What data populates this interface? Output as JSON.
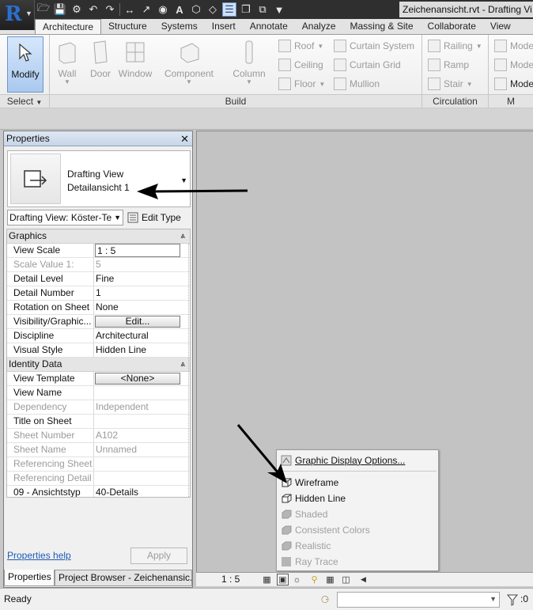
{
  "window": {
    "doc_title": "Zeichenansicht.rvt - Drafting Vi"
  },
  "ribbon": {
    "tabs": [
      "Architecture",
      "Structure",
      "Systems",
      "Insert",
      "Annotate",
      "Analyze",
      "Massing & Site",
      "Collaborate",
      "View"
    ],
    "active_tab": "Architecture",
    "modify_label": "Modify",
    "build_buttons": [
      "Wall",
      "Door",
      "Window",
      "Component",
      "Column"
    ],
    "build_small": [
      "Roof",
      "Ceiling",
      "Floor",
      "Curtain System",
      "Curtain Grid",
      "Mullion"
    ],
    "circulation_small": [
      "Railing",
      "Ramp",
      "Stair"
    ],
    "model_small": [
      "Mode",
      "Mode",
      "Mode"
    ],
    "panels": {
      "select": "Select",
      "build": "Build",
      "circulation": "Circulation",
      "model": "M"
    }
  },
  "properties": {
    "title": "Properties",
    "type_line1": "Drafting View",
    "type_line2": "Detailansicht 1",
    "filter_value": "Drafting View: Köster-Te",
    "edit_type_label": "Edit Type",
    "sections": {
      "graphics": "Graphics",
      "identity": "Identity Data"
    },
    "graphics_rows": [
      {
        "name": "View Scale",
        "value": "1 : 5"
      },
      {
        "name": "Scale Value    1:",
        "value": "5"
      },
      {
        "name": "Detail Level",
        "value": "Fine"
      },
      {
        "name": "Detail Number",
        "value": "1"
      },
      {
        "name": "Rotation on Sheet",
        "value": "None"
      },
      {
        "name": "Visibility/Graphic...",
        "value": "Edit..."
      },
      {
        "name": "Discipline",
        "value": "Architectural"
      },
      {
        "name": "Visual Style",
        "value": "Hidden Line"
      }
    ],
    "identity_rows": [
      {
        "name": "View Template",
        "value": "<None>"
      },
      {
        "name": "View Name",
        "value": ""
      },
      {
        "name": "Dependency",
        "value": "Independent"
      },
      {
        "name": "Title on Sheet",
        "value": ""
      },
      {
        "name": "Sheet Number",
        "value": "A102"
      },
      {
        "name": "Sheet Name",
        "value": "Unnamed"
      },
      {
        "name": "Referencing Sheet",
        "value": ""
      },
      {
        "name": "Referencing Detail",
        "value": ""
      },
      {
        "name": "09 - Ansichtstyp",
        "value": "40-Details"
      }
    ],
    "help_link": "Properties help",
    "apply_label": "Apply",
    "tab_properties": "Properties",
    "tab_browser": "Project Browser - Zeichenansic..."
  },
  "visual_style_menu": {
    "options_label": "Graphic Display Options...",
    "items": [
      "Wireframe",
      "Hidden Line",
      "Shaded",
      "Consistent Colors",
      "Realistic",
      "Ray Trace"
    ]
  },
  "view_bar": {
    "scale": "1 : 5"
  },
  "status": {
    "text": "Ready",
    "count": ":0"
  }
}
